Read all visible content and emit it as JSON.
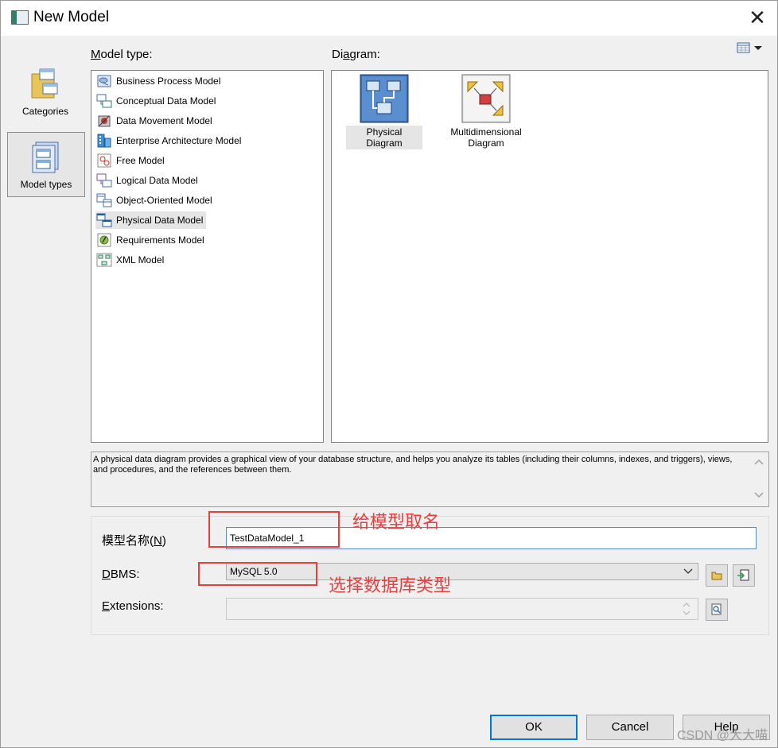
{
  "window": {
    "title": "New Model",
    "close_glyph": "✕"
  },
  "categories": [
    {
      "label": "Categories",
      "icon": "folder-icon",
      "selected": false
    },
    {
      "label": "Model types",
      "icon": "model-types-icon",
      "selected": true
    }
  ],
  "model_type": {
    "label_mnemonic": "M",
    "label_rest": "odel type:",
    "items": [
      {
        "label": "Business Process Model",
        "icon": "business-process-icon"
      },
      {
        "label": "Conceptual Data Model",
        "icon": "conceptual-data-icon"
      },
      {
        "label": "Data Movement Model",
        "icon": "data-movement-icon"
      },
      {
        "label": "Enterprise Architecture Model",
        "icon": "enterprise-architecture-icon"
      },
      {
        "label": "Free Model",
        "icon": "free-model-icon"
      },
      {
        "label": "Logical Data Model",
        "icon": "logical-data-icon"
      },
      {
        "label": "Object-Oriented Model",
        "icon": "object-oriented-icon"
      },
      {
        "label": "Physical Data Model",
        "icon": "physical-data-icon",
        "selected": true
      },
      {
        "label": "Requirements Model",
        "icon": "requirements-icon"
      },
      {
        "label": "XML Model",
        "icon": "xml-model-icon"
      }
    ]
  },
  "diagram": {
    "label_pre": "Di",
    "label_mnemonic": "a",
    "label_rest": "gram:",
    "view_icon": "list-view-icon",
    "items": [
      {
        "label": "Physical Diagram",
        "icon": "physical-diagram-icon",
        "selected": true
      },
      {
        "label": "Multidimensional Diagram",
        "icon": "multidimensional-diagram-icon"
      }
    ]
  },
  "description": "A physical data diagram provides a graphical view of your database structure, and helps you analyze its tables (including their columns, indexes, and triggers), views, and procedures, and the references between them.",
  "form": {
    "name_label_pre": "模型名称(",
    "name_label_mnemonic": "N",
    "name_label_post": ")",
    "name_value": "TestDataModel_1",
    "dbms_label_mnemonic": "D",
    "dbms_label_rest": "BMS:",
    "dbms_value": "MySQL 5.0",
    "extensions_label_mnemonic": "E",
    "extensions_label_rest": "xtensions:",
    "extensions_value": ""
  },
  "annotations": {
    "name_note": "给模型取名",
    "dbms_note": "选择数据库类型",
    "color": "#e8403f"
  },
  "buttons": {
    "ok": "OK",
    "cancel": "Cancel",
    "help": "Help"
  },
  "watermark": "CSDN @大大喵",
  "colors": {
    "accent": "#0078d7",
    "selection": "#e5e5e5",
    "annotation": "#e8403f"
  }
}
